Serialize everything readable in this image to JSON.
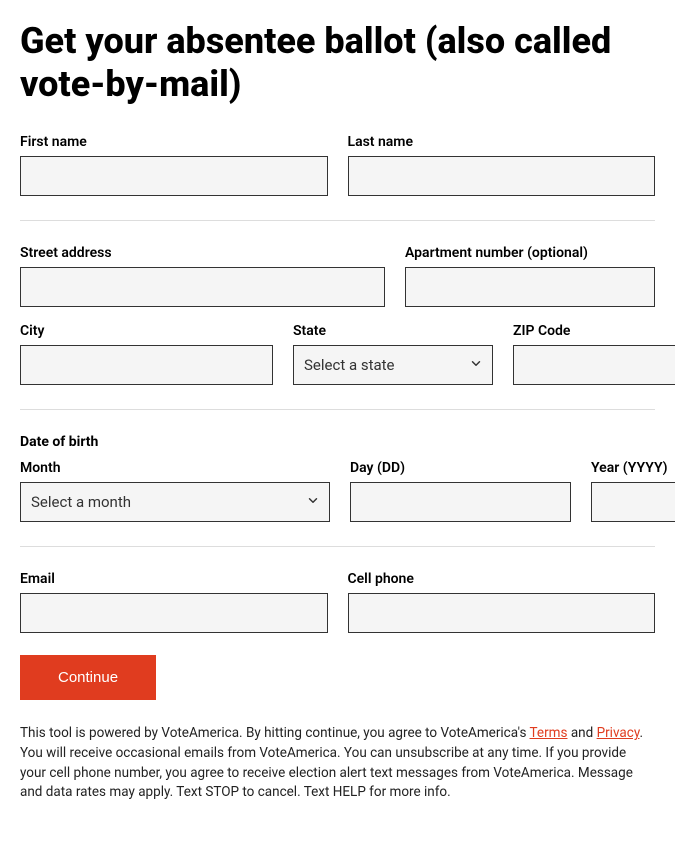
{
  "heading": "Get your absentee ballot (also called vote-by-mail)",
  "labels": {
    "first_name": "First name",
    "last_name": "Last name",
    "street_address": "Street address",
    "apartment": "Apartment number (optional)",
    "city": "City",
    "state": "State",
    "zip": "ZIP Code",
    "dob_section": "Date of birth",
    "month": "Month",
    "day": "Day (DD)",
    "year": "Year (YYYY)",
    "email": "Email",
    "cell_phone": "Cell phone"
  },
  "placeholders": {
    "state": "Select a state",
    "month": "Select a month"
  },
  "values": {
    "first_name": "",
    "last_name": "",
    "street_address": "",
    "apartment": "",
    "city": "",
    "zip": "",
    "day": "",
    "year": "",
    "email": "",
    "cell_phone": ""
  },
  "button": {
    "continue": "Continue"
  },
  "disclaimer": {
    "prefix": "This tool is powered by VoteAmerica. By hitting continue, you agree to VoteAmerica's ",
    "terms": "Terms",
    "and": " and ",
    "privacy": "Privacy",
    "suffix": ". You will receive occasional emails from VoteAmerica. You can unsubscribe at any time. If you provide your cell phone number, you agree to receive election alert text messages from VoteAmerica. Message and data rates may apply. Text STOP to cancel. Text HELP for more info."
  }
}
